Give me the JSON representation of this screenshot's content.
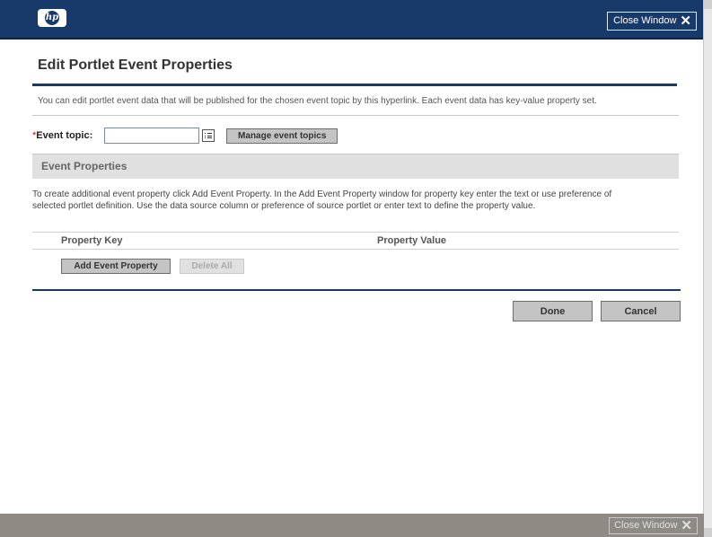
{
  "header": {
    "logo_text": "hp",
    "close_label": "Close Window"
  },
  "page": {
    "title": "Edit Portlet Event Properties",
    "description": "You can edit portlet event data that will be published for the chosen event topic by this hyperlink. Each event data has key-value property set."
  },
  "event_topic": {
    "required_mark": "*",
    "label": "Event topic:",
    "value": "",
    "placeholder": "",
    "manage_label": "Manage event topics"
  },
  "event_properties": {
    "section_title": "Event Properties",
    "help_line1": "To create additional event property click Add Event Property. In the Add Event Property window for property key enter the text or use preference of",
    "help_line2": "selected portlet definition. Use the data source column or preference of source portlet or enter text to define the property value.",
    "columns": [
      "Property Key",
      "Property Value"
    ],
    "add_label": "Add Event Property",
    "delete_all_label": "Delete All"
  },
  "actions": {
    "done_label": "Done",
    "cancel_label": "Cancel"
  },
  "footer": {
    "close_label": "Close Window"
  },
  "colors": {
    "brand": "#173a6b",
    "footer": "#8e8a84",
    "required": "#dd0000"
  }
}
